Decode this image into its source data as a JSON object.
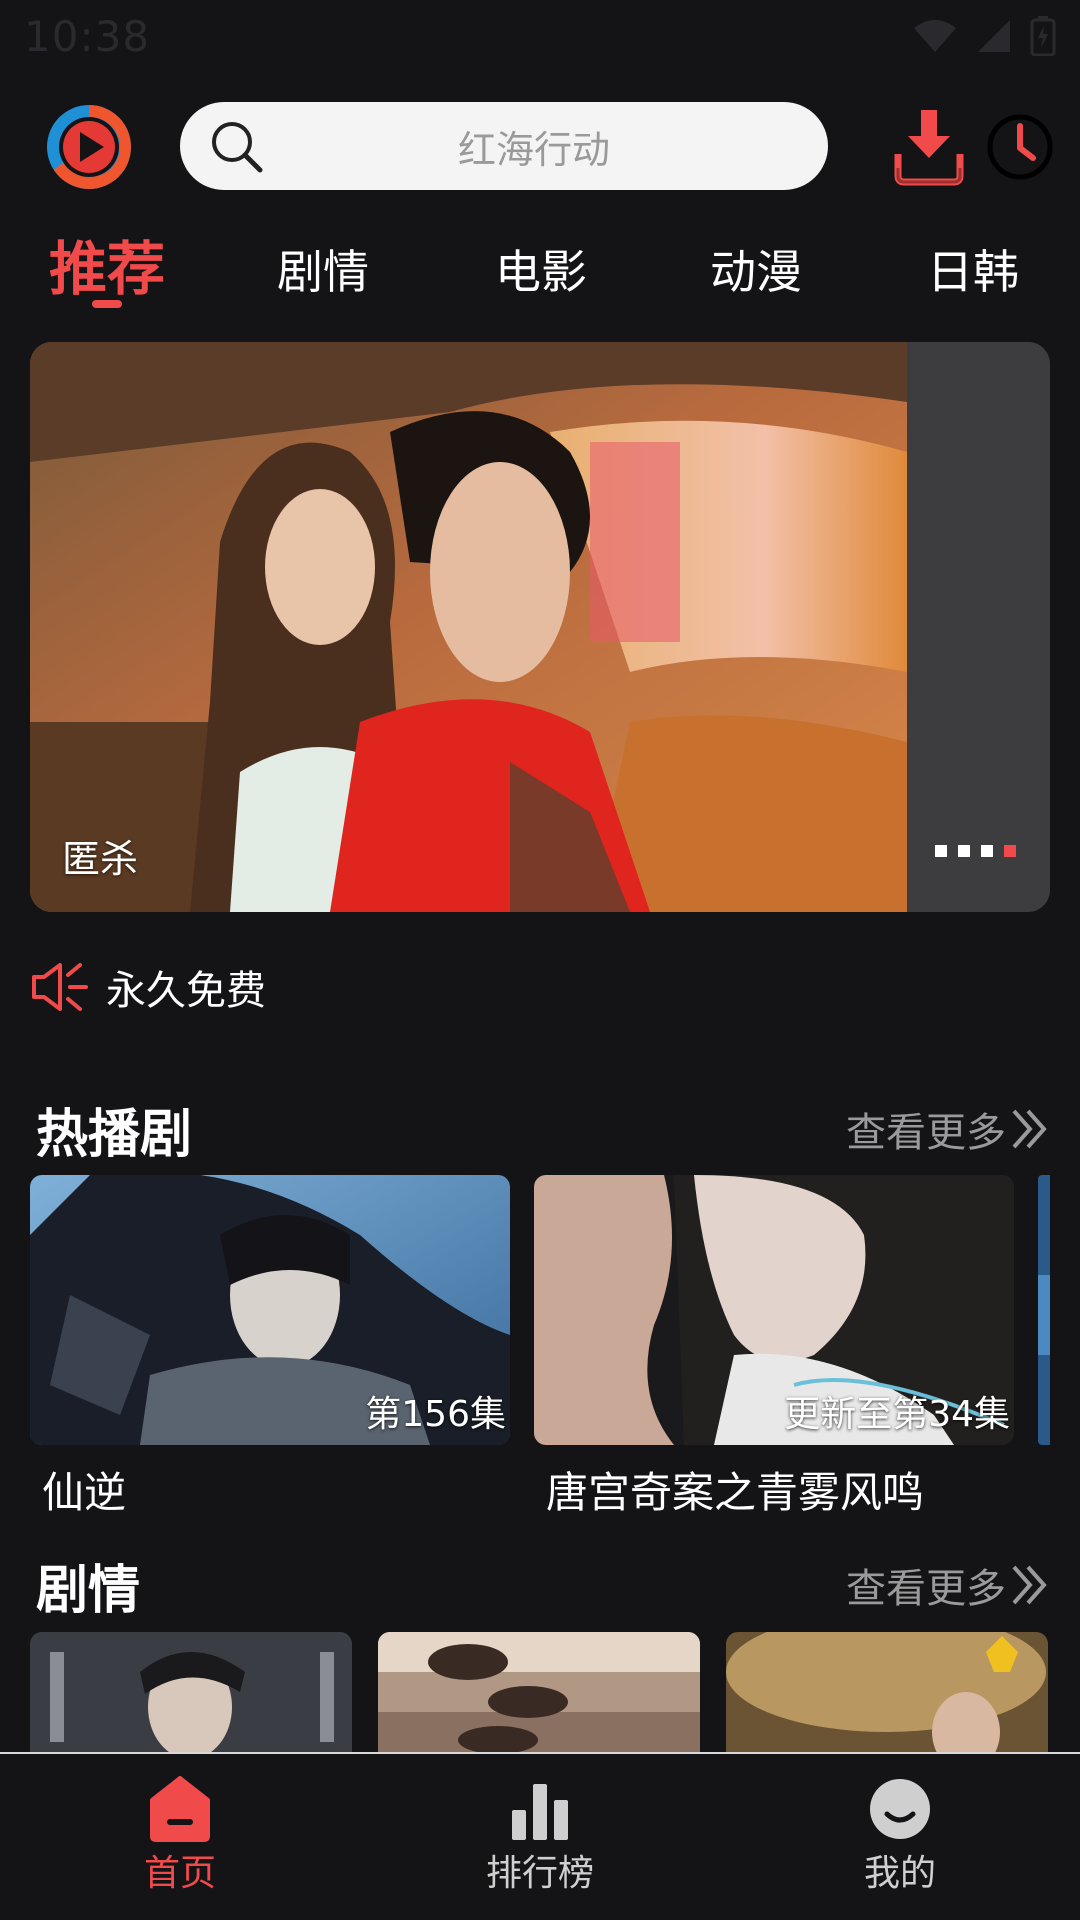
{
  "status_bar": {
    "time": "10:38"
  },
  "header": {
    "search_placeholder": "红海行动"
  },
  "tabs": [
    {
      "label": "推荐",
      "active": true
    },
    {
      "label": "剧情",
      "active": false
    },
    {
      "label": "电影",
      "active": false
    },
    {
      "label": "动漫",
      "active": false
    },
    {
      "label": "日韩",
      "active": false
    }
  ],
  "banner": {
    "title": "匿杀",
    "page_count": 4,
    "active_page": 4
  },
  "notice": {
    "text": "永久免费"
  },
  "hot_section": {
    "title": "热播剧",
    "more_label": "查看更多",
    "items": [
      {
        "name": "仙逆",
        "episode": "第156集"
      },
      {
        "name": "唐宫奇案之青雾风鸣",
        "episode": "更新至第34集"
      }
    ]
  },
  "drama_section": {
    "title": "剧情",
    "more_label": "查看更多"
  },
  "bottom_nav": [
    {
      "label": "首页",
      "icon": "home-icon",
      "active": true
    },
    {
      "label": "排行榜",
      "icon": "ranking-icon",
      "active": false
    },
    {
      "label": "我的",
      "icon": "profile-icon",
      "active": false
    }
  ],
  "colors": {
    "accent": "#f04a4a",
    "background": "#141417",
    "search_bg": "#f4f4f4",
    "muted_text": "#9a9a9a"
  }
}
